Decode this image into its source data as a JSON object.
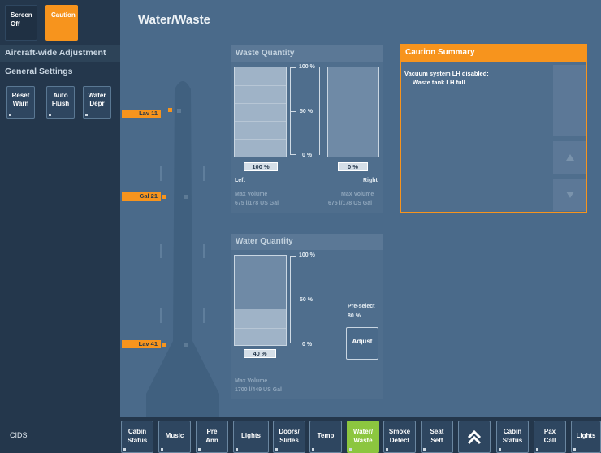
{
  "header": {
    "screen_off_line1": "Screen",
    "screen_off_line2": "Off",
    "caution_label": "Caution",
    "page_title": "Water/Waste"
  },
  "sidebar": {
    "section_title": "Aircraft-wide Adjustment",
    "group_title": "General Settings",
    "buttons": [
      {
        "line1": "Reset",
        "line2": "Warn"
      },
      {
        "line1": "Auto",
        "line2": "Flush"
      },
      {
        "line1": "Water",
        "line2": "Depr"
      }
    ]
  },
  "aircraft": {
    "zones": [
      "Lav 11",
      "Gal 21",
      "Lav 41"
    ]
  },
  "waste": {
    "title": "Waste Quantity",
    "scale": [
      "100 %",
      "50 %",
      "0 %"
    ],
    "left": {
      "label": "Left",
      "percent_label": "100 %",
      "percent": 100,
      "max_label": "Max Volume",
      "max_value": "675 l/178 US Gal"
    },
    "right": {
      "label": "Right",
      "percent_label": "0 %",
      "percent": 0,
      "max_label": "Max Volume",
      "max_value": "675 l/178 US Gal"
    }
  },
  "water": {
    "title": "Water Quantity",
    "scale": [
      "100 %",
      "50 %",
      "0 %"
    ],
    "percent_label": "40 %",
    "percent": 40,
    "preselect_label": "Pre-select",
    "preselect_value": "80 %",
    "adjust_label": "Adjust",
    "max_label": "Max Volume",
    "max_value": "1700 l/449 US Gal"
  },
  "caution_summary": {
    "title": "Caution Summary",
    "line1": "Vacuum system LH disabled:",
    "line2": "Waste tank LH full"
  },
  "bottom": {
    "cids": "CIDS",
    "nav": [
      {
        "line1": "Cabin",
        "line2": "Status"
      },
      {
        "line1": "Music",
        "line2": ""
      },
      {
        "line1": "Pre",
        "line2": "Ann"
      },
      {
        "line1": "Lights",
        "line2": ""
      },
      {
        "line1": "Doors/",
        "line2": "Slides"
      },
      {
        "line1": "Temp",
        "line2": ""
      },
      {
        "line1": "Water/",
        "line2": "Waste"
      },
      {
        "line1": "Smoke",
        "line2": "Detect"
      },
      {
        "line1": "Seat",
        "line2": "Sett"
      },
      {
        "line1": "Cabin",
        "line2": "Status"
      },
      {
        "line1": "Pax",
        "line2": "Call"
      },
      {
        "line1": "Lights",
        "line2": ""
      }
    ]
  },
  "colors": {
    "accent": "#f7941d",
    "active_nav": "#8cc63f",
    "background": "#4a6a8a"
  }
}
